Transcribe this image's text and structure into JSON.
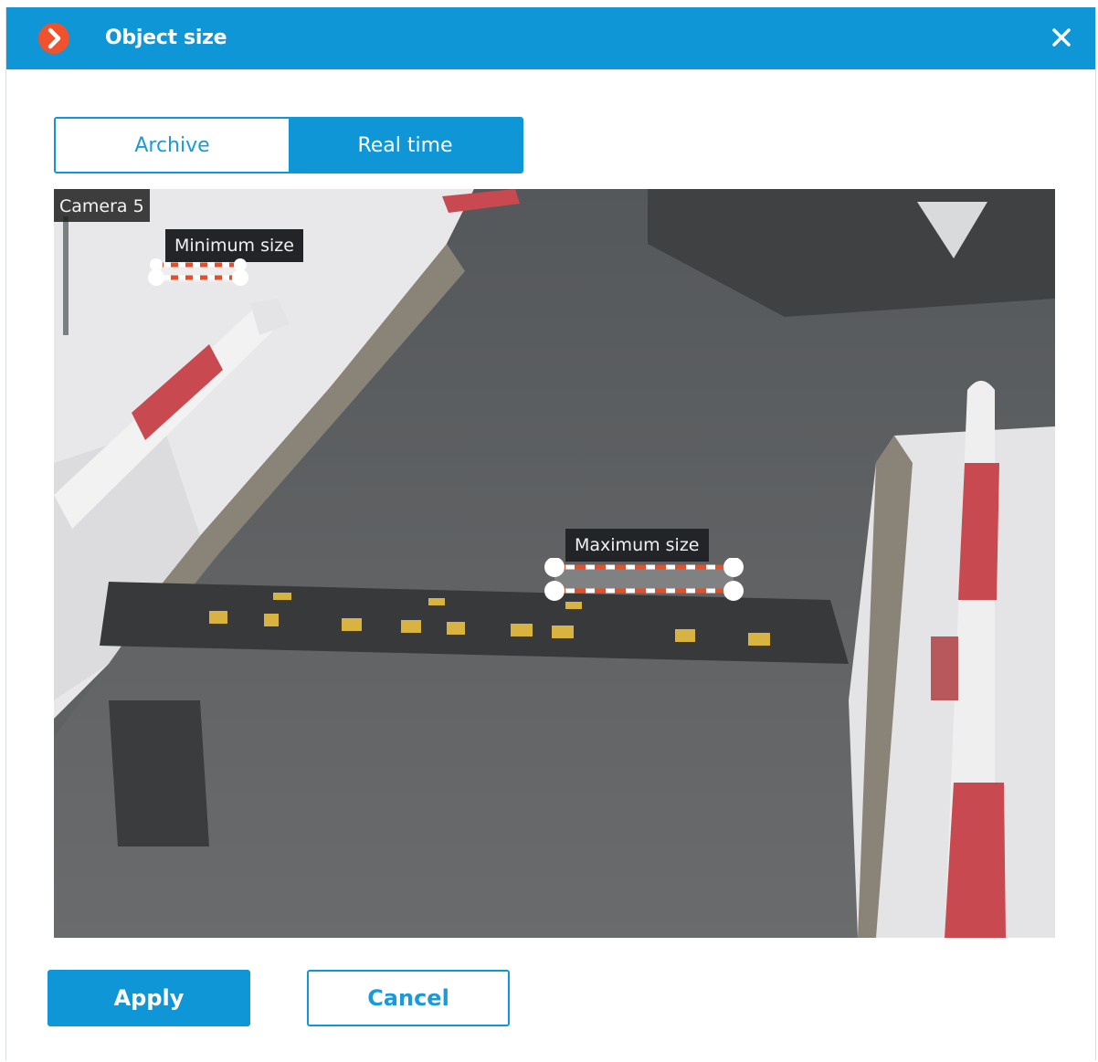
{
  "window": {
    "title": "Object size",
    "app_icon": "chevron-right-icon",
    "close_icon": "close-icon"
  },
  "tabs": [
    {
      "label": "Archive",
      "active": false
    },
    {
      "label": "Real time",
      "active": true
    }
  ],
  "camera": {
    "label": "Camera 5",
    "min_label": "Minimum size",
    "max_label": "Maximum size"
  },
  "buttons": {
    "apply": "Apply",
    "cancel": "Cancel"
  },
  "colors": {
    "accent": "#0e96d6",
    "app_icon": "#f0522d",
    "marker_dash": "#e0522c"
  }
}
